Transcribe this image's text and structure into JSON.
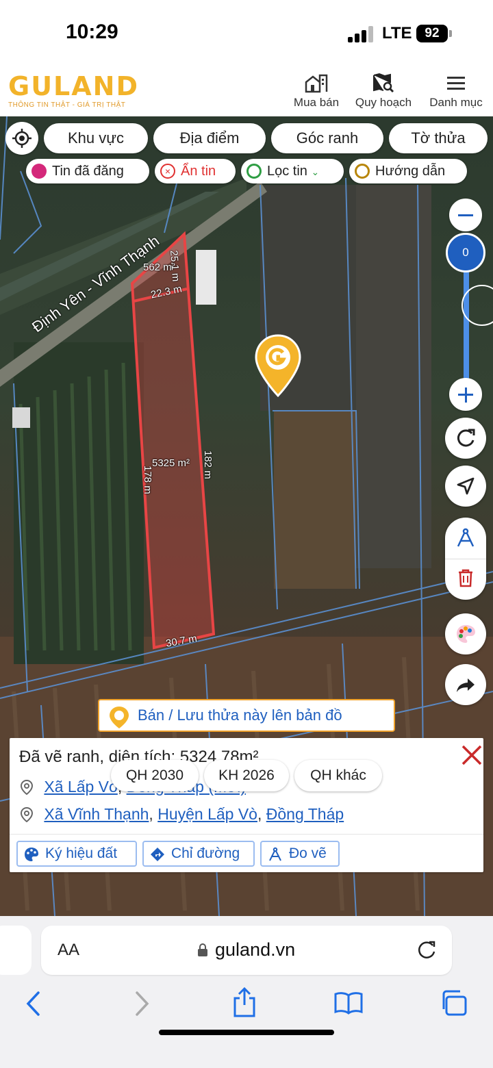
{
  "status_bar": {
    "time": "10:29",
    "network": "LTE",
    "battery": "92"
  },
  "header": {
    "logo": "GULAND",
    "tagline": "THÔNG TIN THẬT - GIÁ TRỊ THẬT",
    "nav": [
      {
        "label": "Mua bán",
        "icon": "buildings-icon"
      },
      {
        "label": "Quy hoạch",
        "icon": "map-search-icon"
      },
      {
        "label": "Danh mục",
        "icon": "menu-icon"
      }
    ]
  },
  "filters": {
    "row1": [
      "Khu vực",
      "Địa điểm",
      "Góc ranh",
      "Tờ thửa"
    ],
    "row2": [
      {
        "label": "Tin đã đăng",
        "icon": "posted-icon",
        "color": "#d4287a"
      },
      {
        "label": "Ẩn tin",
        "icon": "hide-icon",
        "color": "#e03131"
      },
      {
        "label": "Lọc tin",
        "icon": "filter-icon",
        "color": "#2f9e44"
      },
      {
        "label": "Hướng dẫn",
        "icon": "guide-icon",
        "color": "#b8860b"
      }
    ]
  },
  "map": {
    "road_label": "Định Yên - Vĩnh Thạnh",
    "zoom_level": "0",
    "parcel_labels": {
      "area_top": "562 m²",
      "top_right": "25.1 m",
      "mid_width": "22.3 m",
      "area_main": "5325 m²",
      "left_side": "178 m",
      "right_side": "182 m",
      "bottom": "30.7 m"
    },
    "highlight_color": "#e84545"
  },
  "sell_button": "Bán / Lưu thửa này lên bản đồ",
  "info_panel": {
    "title": "Đã vẽ ranh, diện tích: 5324.78m²",
    "address1": [
      "Xã Lấp Vò",
      "Đồng Tháp (Mới)"
    ],
    "address2": [
      "Xã Vĩnh Thạnh",
      "Huyện Lấp Vò",
      "Đồng Tháp"
    ],
    "buttons": [
      "Ký hiệu đất",
      "Chỉ đường",
      "Đo vẽ"
    ]
  },
  "plan_tabs": [
    "QH 2030",
    "KH 2026",
    "QH khác"
  ],
  "browser": {
    "aa": "AA",
    "url": "guland.vn"
  },
  "accent": "#1f5fbf",
  "brand": "#f2b32a"
}
